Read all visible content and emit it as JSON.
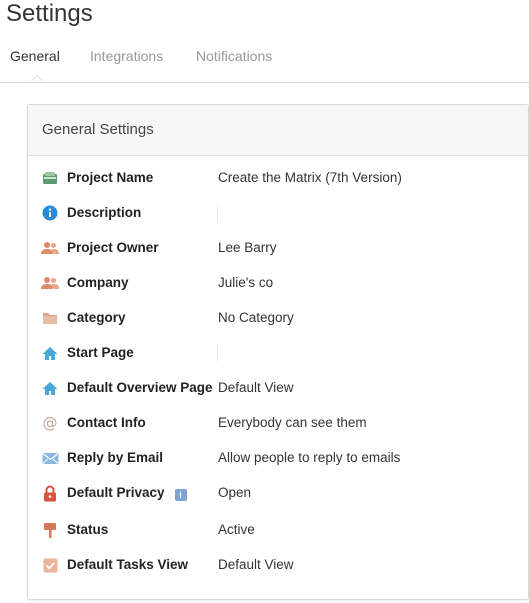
{
  "page": {
    "title": "Settings"
  },
  "tabs": [
    {
      "label": "General",
      "active": true
    },
    {
      "label": "Integrations",
      "active": false
    },
    {
      "label": "Notifications",
      "active": false
    }
  ],
  "panel": {
    "title": "General Settings"
  },
  "rows": [
    {
      "icon": "project-box-icon",
      "label": "Project Name",
      "value": "Create the Matrix (7th Version)"
    },
    {
      "icon": "info-circle-icon",
      "label": "Description",
      "value": ""
    },
    {
      "icon": "people-icon",
      "label": "Project Owner",
      "value": "Lee Barry"
    },
    {
      "icon": "people-icon",
      "label": "Company",
      "value": "Julie's co"
    },
    {
      "icon": "folder-icon",
      "label": "Category",
      "value": "No Category"
    },
    {
      "icon": "home-icon",
      "label": "Start Page",
      "value": ""
    },
    {
      "icon": "home-icon",
      "label": "Default Overview Page",
      "value": "Default View"
    },
    {
      "icon": "at-sign-icon",
      "label": "Contact Info",
      "value": "Everybody can see them"
    },
    {
      "icon": "envelope-icon",
      "label": "Reply by Email",
      "value": "Allow people to reply to emails"
    },
    {
      "icon": "lock-icon",
      "label": "Default Privacy",
      "value": "Open"
    },
    {
      "icon": "signpost-icon",
      "label": "Status",
      "value": "Active"
    },
    {
      "icon": "checkbox-icon",
      "label": "Default Tasks View",
      "value": "Default View"
    }
  ],
  "colors": {
    "people": "#e08a6a",
    "info": "#2b8ad6",
    "home": "#4aa8d8",
    "lock": "#d6533d",
    "folder": "#d9a58a",
    "checkbox": "#e0a58a",
    "envelope": "#6fa6d6",
    "at": "#c9a093"
  }
}
